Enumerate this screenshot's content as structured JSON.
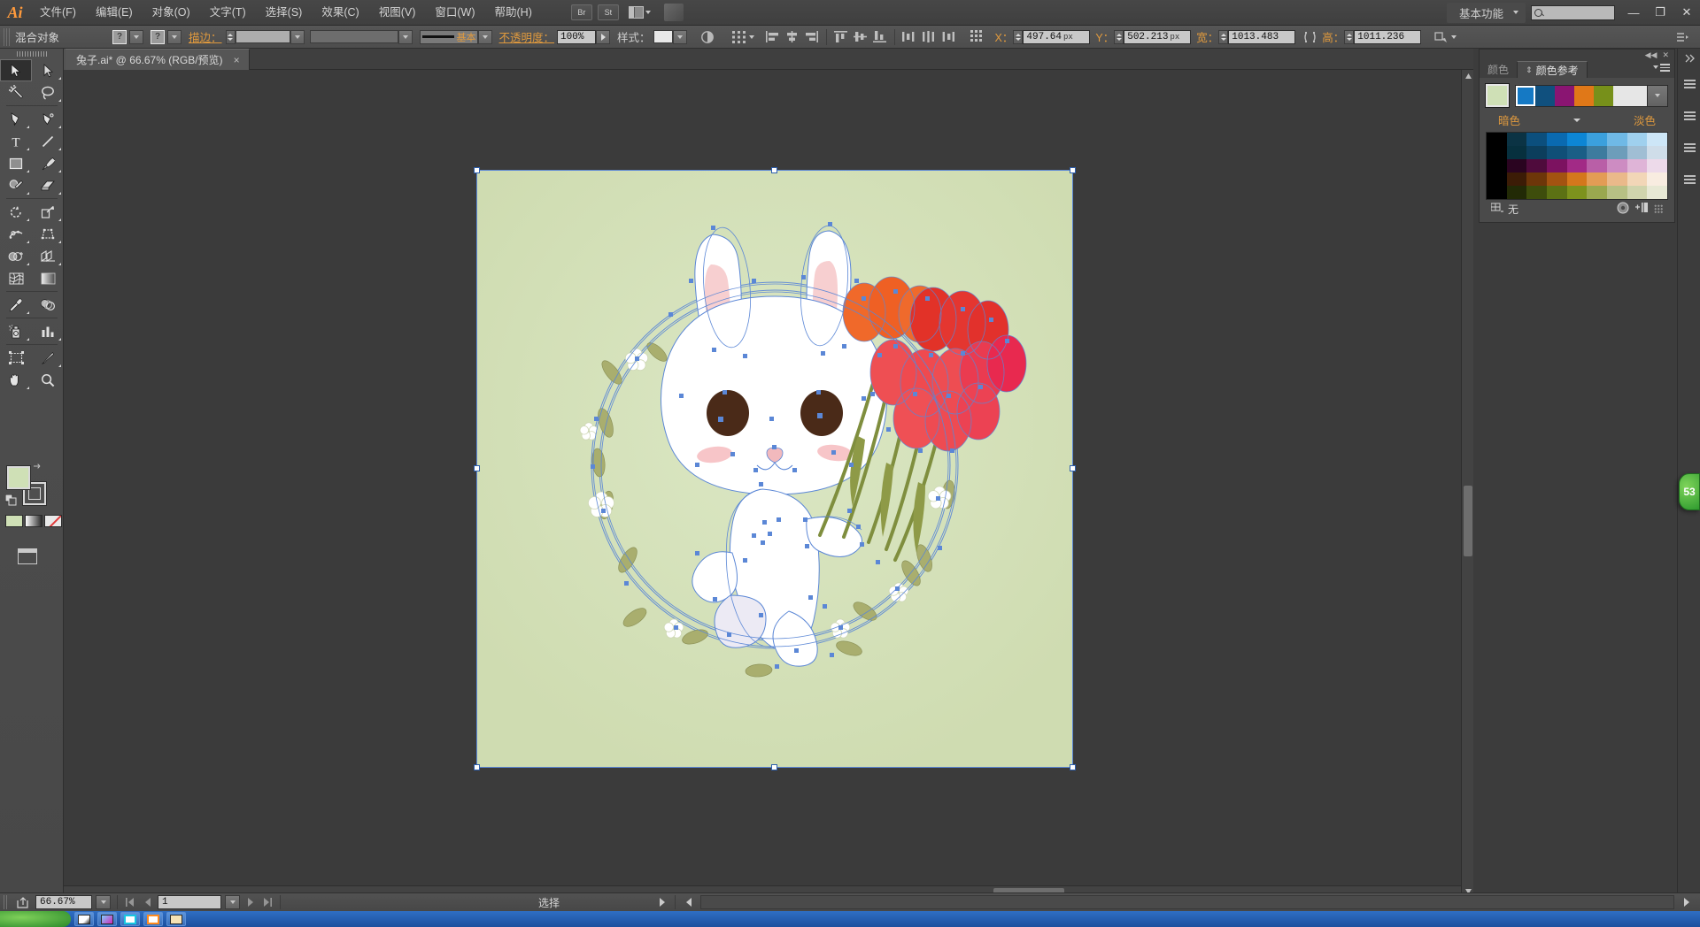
{
  "app": {
    "name": "Adobe Illustrator",
    "logo": "Ai"
  },
  "menubar": {
    "items": [
      {
        "label": "文件(F)",
        "name": "menu-file"
      },
      {
        "label": "编辑(E)",
        "name": "menu-edit"
      },
      {
        "label": "对象(O)",
        "name": "menu-object"
      },
      {
        "label": "文字(T)",
        "name": "menu-type"
      },
      {
        "label": "选择(S)",
        "name": "menu-select"
      },
      {
        "label": "效果(C)",
        "name": "menu-effect"
      },
      {
        "label": "视图(V)",
        "name": "menu-view"
      },
      {
        "label": "窗口(W)",
        "name": "menu-window"
      },
      {
        "label": "帮助(H)",
        "name": "menu-help"
      }
    ],
    "bridge_button": "Br",
    "stock_button": "St",
    "workspace_label": "基本功能",
    "search_placeholder": "",
    "window_buttons": {
      "minimize": "—",
      "restore": "❐",
      "close": "✕"
    }
  },
  "controlbar": {
    "object_type": "混合对象",
    "fill_swatch_label": "?",
    "stroke_swatch_label": "?",
    "stroke_label": "描边：",
    "stroke_weight": "",
    "stroke_profile": "",
    "brush_label": "基本",
    "opacity_label": "不透明度：",
    "opacity_value": "100%",
    "style_label": "样式：",
    "x_label": "X：",
    "x_value": "497.64",
    "x_unit": "px",
    "y_label": "Y：",
    "y_value": "502.213",
    "y_unit": "px",
    "w_label": "宽：",
    "w_value": "1013.483",
    "h_label": "高：",
    "h_value": "1011.236"
  },
  "document": {
    "tab_title": "兔子.ai* @ 66.67% (RGB/预览)",
    "close_label": "×"
  },
  "toolbar": {
    "tools": [
      {
        "name": "selection-tool",
        "label": "选择工具",
        "selected": true
      },
      {
        "name": "direct-selection-tool",
        "label": "直接选择工具"
      },
      {
        "name": "magic-wand-tool",
        "label": "魔棒工具"
      },
      {
        "name": "lasso-tool",
        "label": "套索工具"
      },
      {
        "name": "pen-tool",
        "label": "钢笔工具"
      },
      {
        "name": "curvature-tool",
        "label": "曲率工具"
      },
      {
        "name": "type-tool",
        "label": "文字工具"
      },
      {
        "name": "line-segment-tool",
        "label": "直线段工具"
      },
      {
        "name": "rectangle-tool",
        "label": "矩形工具"
      },
      {
        "name": "paintbrush-tool",
        "label": "画笔工具"
      },
      {
        "name": "shaper-tool",
        "label": "Shaper 工具"
      },
      {
        "name": "eraser-tool",
        "label": "橡皮擦工具"
      },
      {
        "name": "rotate-tool",
        "label": "旋转工具"
      },
      {
        "name": "scale-tool",
        "label": "比例缩放工具"
      },
      {
        "name": "width-tool",
        "label": "宽度工具"
      },
      {
        "name": "free-transform-tool",
        "label": "自由变换工具"
      },
      {
        "name": "shape-builder-tool",
        "label": "形状生成器工具"
      },
      {
        "name": "perspective-grid-tool",
        "label": "透视网格工具"
      },
      {
        "name": "mesh-tool",
        "label": "网格工具"
      },
      {
        "name": "gradient-tool",
        "label": "渐变工具"
      },
      {
        "name": "eyedropper-tool",
        "label": "吸管工具"
      },
      {
        "name": "blend-tool",
        "label": "混合工具"
      },
      {
        "name": "symbol-sprayer-tool",
        "label": "符号喷枪工具"
      },
      {
        "name": "column-graph-tool",
        "label": "柱形图工具"
      },
      {
        "name": "artboard-tool",
        "label": "画板工具"
      },
      {
        "name": "slice-tool",
        "label": "切片工具"
      },
      {
        "name": "hand-tool",
        "label": "抓手工具"
      },
      {
        "name": "zoom-tool",
        "label": "缩放工具"
      }
    ],
    "fill_color": "#cfe0b6",
    "stroke_color": "#4f4f4f",
    "fill_mode_color": "颜色",
    "fill_mode_gradient": "渐变",
    "fill_mode_none": "无"
  },
  "canvas": {
    "artboard_background": "#d3e0b5",
    "selection_color": "#5b87d6",
    "artwork": {
      "title": "兔子与郁金香插画",
      "rabbit_body": "#ffffff",
      "rabbit_outline": "#5b87d6",
      "ear_inner": "#f8cdcd",
      "cheek": "#f8c8cc",
      "eye": "#4a2a18",
      "flower_orange": "#f06c2a",
      "flower_red": "#e8352e",
      "flower_pink": "#ef4a5c",
      "stem_green": "#7f8e3e",
      "leaf_green": "#a8ad6b",
      "wreath_flower": "#ffffff"
    }
  },
  "right_panel": {
    "tabs": [
      {
        "label": "颜色",
        "name": "tab-color",
        "active": false
      },
      {
        "label": "颜色参考",
        "name": "tab-color-guide",
        "active": true
      }
    ],
    "base_color": "#cfe0b6",
    "harmony_swatches": [
      "#1579c4",
      "#10507e",
      "#8a1572",
      "#e07818",
      "#77901a"
    ],
    "shades_label": "暗色",
    "tints_label": "淡色",
    "footer_none_label": "无",
    "swatch_rows": [
      [
        "#000000",
        "#0b3344",
        "#0c4f7d",
        "#0a6ab0",
        "#0d86d4",
        "#3ba0dd",
        "#6fb9e6",
        "#9fd0ee",
        "#cde6f7"
      ],
      [
        "#000000",
        "#07303e",
        "#0c3e5c",
        "#104f77",
        "#1a5e86",
        "#3d7b9e",
        "#6d9dba",
        "#a0bed4",
        "#cfdde9"
      ],
      [
        "#000000",
        "#2a0420",
        "#4f0b3c",
        "#7c1260",
        "#a22a86",
        "#b95fa7",
        "#cd8cc2",
        "#dfb4d7",
        "#eddaea"
      ],
      [
        "#000000",
        "#3c1c06",
        "#6d3609",
        "#a35311",
        "#d4771c",
        "#e39c55",
        "#eab98a",
        "#f2d6b7",
        "#f8ece0"
      ],
      [
        "#000000",
        "#222a06",
        "#3e4d0c",
        "#5c7114",
        "#7d921d",
        "#9aa84f",
        "#b7c084",
        "#d0d4ad",
        "#e7e8d4"
      ]
    ]
  },
  "statusbar": {
    "zoom_value": "66.67%",
    "page_value": "1",
    "status_text": "选择"
  },
  "floating_tab": {
    "label": "53"
  }
}
